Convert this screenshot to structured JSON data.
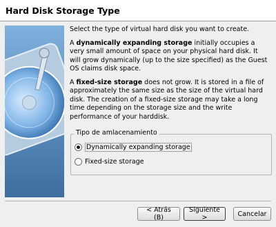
{
  "header": {
    "title": "Hard Disk Storage Type"
  },
  "content": {
    "intro": "Select the type of virtual hard disk you want to create.",
    "dynamic": {
      "lead": "A ",
      "bold": "dynamically expanding storage",
      "rest": " initially occupies a very small amount of space on your physical hard disk. It will grow dynamically (up to the size specified) as the Guest OS claims disk space."
    },
    "fixed": {
      "lead": "A ",
      "bold": "fixed-size storage",
      "rest": " does not grow. It is stored in a file of approximately the same size as the size of the virtual hard disk. The creation of a fixed-size storage may take a long time depending on the storage size and the write performance of your harddisk."
    }
  },
  "storage_group": {
    "title": "Tipo de amlacenamiento",
    "options": [
      {
        "label": "Dynamically expanding storage",
        "selected": true
      },
      {
        "label": "Fixed-size storage",
        "selected": false
      }
    ]
  },
  "buttons": {
    "back": "< Atrás (B)",
    "next": "Siguiente >",
    "cancel": "Cancelar"
  },
  "colors": {
    "art_background": "#5b8fc0",
    "dialog_background": "#efefef"
  }
}
